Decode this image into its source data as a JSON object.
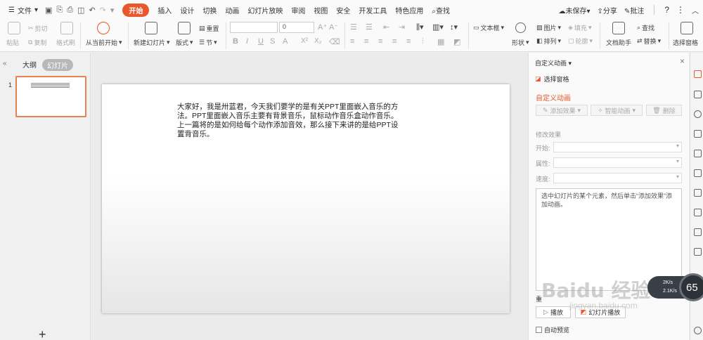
{
  "menubar": {
    "file_label": "文件",
    "tabs": [
      "开始",
      "插入",
      "设计",
      "切换",
      "动画",
      "幻灯片放映",
      "审阅",
      "视图",
      "安全",
      "开发工具",
      "特色应用"
    ],
    "search_label": "查找",
    "save_status": "未保存",
    "share_label": "分享",
    "annotate_label": "批注"
  },
  "ribbon": {
    "paste": "粘贴",
    "cut": "剪切",
    "copy": "复制",
    "format_painter": "格式刷",
    "play_from_current": "从当前开始",
    "new_slide": "新建幻灯片",
    "layout": "版式",
    "reset": "重置",
    "section": "节",
    "font_size": "0",
    "text_box": "文本框",
    "shape": "形状",
    "picture": "图片",
    "fill": "填充",
    "arrange": "排列",
    "outline": "轮廓",
    "doc_assistant": "文档助手",
    "find": "查找",
    "replace": "替换",
    "select_pane": "选择窗格"
  },
  "left_panel": {
    "tab_outline": "大纲",
    "tab_slides": "幻灯片",
    "slide_number": "1",
    "add_symbol": "+"
  },
  "slide": {
    "lines": [
      "大家好，我是卅蓝君，今天我们要学的是有关PPT里面嵌入音乐的方",
      "法。PPT里面嵌入音乐主要有背景音乐，鼠标动作音乐盒动作音乐。",
      "上一篇将的是如何给每个动作添加音效，那么接下来讲的是给PPT设",
      "置背音乐。"
    ]
  },
  "task_pane": {
    "title": "自定义动画",
    "select_pane": "选择窗格",
    "section_title": "自定义动画",
    "add_effect": "添加效果",
    "smart_animation": "智能动画",
    "delete": "删除",
    "modify_effect": "修改效果",
    "start_label": "开始:",
    "property_label": "属性:",
    "speed_label": "速度:",
    "hint": "选中幻灯片的某个元素，然后单击“添加效果”添加动画。",
    "reorder_label": "重",
    "play": "播放",
    "slideshow": "幻灯片播放",
    "auto_preview": "自动预览"
  },
  "speed_widget": {
    "up": "2K/s",
    "down": "2.1K/s",
    "percent": "65"
  },
  "watermark": {
    "main": "Baidu 经验",
    "sub": "jingyan.baidu.com"
  }
}
